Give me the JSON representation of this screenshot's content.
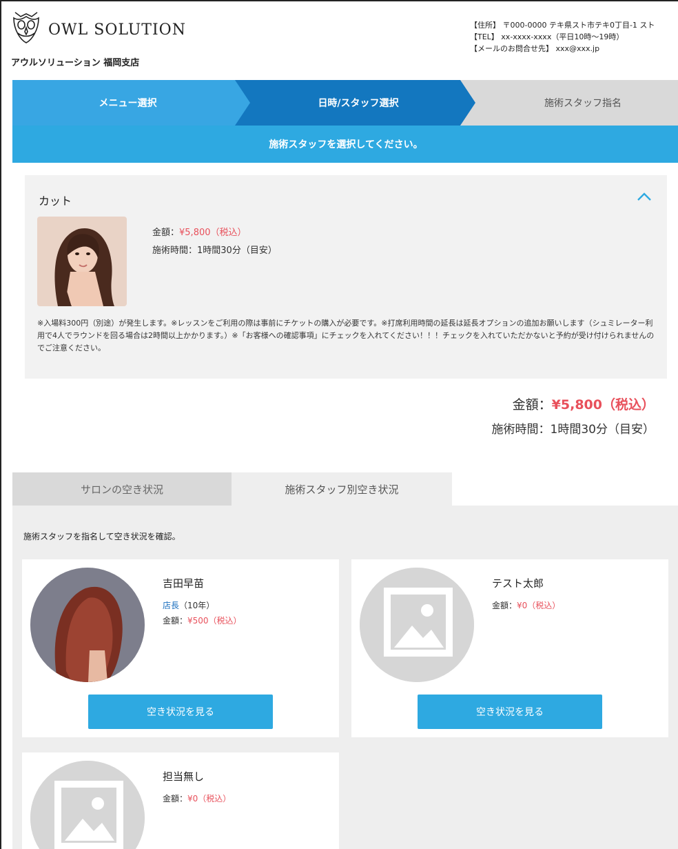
{
  "header": {
    "brand": "OWL SOLUTION",
    "branch": "アウルソリューション 福岡支店",
    "address": "【住所】 〒000-0000 テキ県スト市テキ0丁目-1 スト",
    "tel": "【TEL】 xx-xxxx-xxxx（平日10時～19時）",
    "email": "【メールのお問合せ先】 xxx@xxx.jp"
  },
  "steps": [
    {
      "label": "メニュー選択",
      "state": "done"
    },
    {
      "label": "日時/スタッフ選択",
      "state": "current"
    },
    {
      "label": "施術スタッフ指名",
      "state": "upcoming"
    }
  ],
  "notice": "施術スタッフを選択してください。",
  "menu": {
    "title": "カット",
    "price_label": "金額：",
    "price_value": "¥5,800（税込）",
    "time": "施術時間：1時間30分（目安）",
    "description": "※入場料300円（別途）が発生します。※レッスンをご利用の際は事前にチケットの購入が必要です。※打席利用時間の延長は延長オプションの追加お願いします（シュミレーター利用で4人でラウンドを回る場合は2時間以上かかります。）※「お客様への確認事項」にチェックを入れてください！！！チェックを入れていただかないと予約が受け付けられませんのでご注意ください。"
  },
  "total": {
    "price_label": "金額：",
    "price_value": "¥5,800（税込）",
    "time": "施術時間：1時間30分（目安）"
  },
  "tabs": [
    {
      "label": "サロンの空き状況",
      "active": false
    },
    {
      "label": "施術スタッフ別空き状況",
      "active": true
    }
  ],
  "staff_hint": "施術スタッフを指名して空き状況を確認。",
  "staff": [
    {
      "name": "吉田早苗",
      "role": "店長",
      "years": "（10年）",
      "price_label": "金額：",
      "price_value": "¥500（税込）",
      "button": "空き状況を見る",
      "photo": "staff-photo"
    },
    {
      "name": "テスト太郎",
      "price_label": "金額：",
      "price_value": "¥0（税込）",
      "button": "空き状況を見る",
      "photo": "placeholder-image-icon"
    },
    {
      "name": "担当無し",
      "price_label": "金額：",
      "price_value": "¥0（税込）",
      "photo": "placeholder-image-icon"
    }
  ],
  "colors": {
    "accent_blue": "#2ea9e1",
    "step_current": "#1377bf",
    "price_red": "#e8505b",
    "role_blue": "#1b6fbf"
  }
}
